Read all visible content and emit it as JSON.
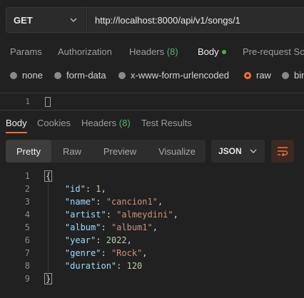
{
  "request": {
    "method": "GET",
    "url": "http://localhost:8000/api/v1/songs/1"
  },
  "request_tabs": {
    "params": "Params",
    "authorization": "Authorization",
    "headers": "Headers",
    "headers_count": "(8)",
    "body": "Body",
    "prerequest": "Pre-request Scr"
  },
  "body_types": {
    "none": "none",
    "form_data": "form-data",
    "urlencoded": "x-www-form-urlencoded",
    "raw": "raw",
    "binary": "bin"
  },
  "request_editor": {
    "line1": "1"
  },
  "response_tabs": {
    "body": "Body",
    "cookies": "Cookies",
    "headers": "Headers",
    "headers_count": "(8)",
    "test_results": "Test Results"
  },
  "view_modes": {
    "pretty": "Pretty",
    "raw": "Raw",
    "preview": "Preview",
    "visualize": "Visualize"
  },
  "format_select": "JSON",
  "response_lines": [
    {
      "n": "1",
      "open": "{"
    },
    {
      "n": "2",
      "key": "\"id\"",
      "sep": ": ",
      "val": "1",
      "type": "num",
      "end": ","
    },
    {
      "n": "3",
      "key": "\"name\"",
      "sep": ": ",
      "val": "\"cancion1\"",
      "type": "str",
      "end": ","
    },
    {
      "n": "4",
      "key": "\"artist\"",
      "sep": ": ",
      "val": "\"almeydini\"",
      "type": "str",
      "end": ","
    },
    {
      "n": "5",
      "key": "\"album\"",
      "sep": ": ",
      "val": "\"album1\"",
      "type": "str",
      "end": ","
    },
    {
      "n": "6",
      "key": "\"year\"",
      "sep": ": ",
      "val": "2022",
      "type": "num",
      "end": ","
    },
    {
      "n": "7",
      "key": "\"genre\"",
      "sep": ": ",
      "val": "\"Rock\"",
      "type": "str",
      "end": ","
    },
    {
      "n": "8",
      "key": "\"duration\"",
      "sep": ": ",
      "val": "120",
      "type": "num",
      "end": ""
    },
    {
      "n": "9",
      "close": "}"
    }
  ],
  "colors": {
    "accent": "#ff6c37",
    "success": "#3bb554"
  }
}
